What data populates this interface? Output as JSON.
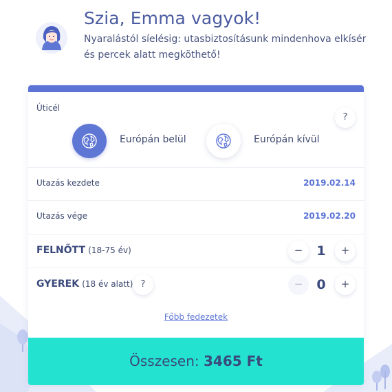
{
  "hero": {
    "greeting": "Szia, Emma vagyok!",
    "subtitle": "Nyaralástól síelésig: utasbiztosításunk mindenhova elkísér és percek alatt megköthető!",
    "avatar_icon": "emma-avatar-icon"
  },
  "destination": {
    "label": "Úticél",
    "help": "?",
    "options": [
      {
        "label": "Európán belül",
        "icon": "globe-europe-icon",
        "selected": true
      },
      {
        "label": "Európán kívül",
        "icon": "globe-world-icon",
        "selected": false
      }
    ]
  },
  "trip": {
    "start_label": "Utazás kezdete",
    "start_value": "2019.02.14",
    "end_label": "Utazás vége",
    "end_value": "2019.02.20"
  },
  "travelers": {
    "adult": {
      "title": "FELNŐTT",
      "range": "(18-75 év)",
      "count": "1",
      "minus": "−",
      "plus": "+"
    },
    "child": {
      "title": "GYEREK",
      "range": "(18 év alatt)",
      "help": "?",
      "count": "0",
      "minus": "−",
      "plus": "+"
    }
  },
  "coverage_link": "Főbb fedezetek",
  "total": {
    "label": "Összesen:",
    "value": "3465 Ft"
  },
  "colors": {
    "accent": "#5b74d6",
    "total_bar": "#23e3d0",
    "text": "#3e4a70"
  }
}
